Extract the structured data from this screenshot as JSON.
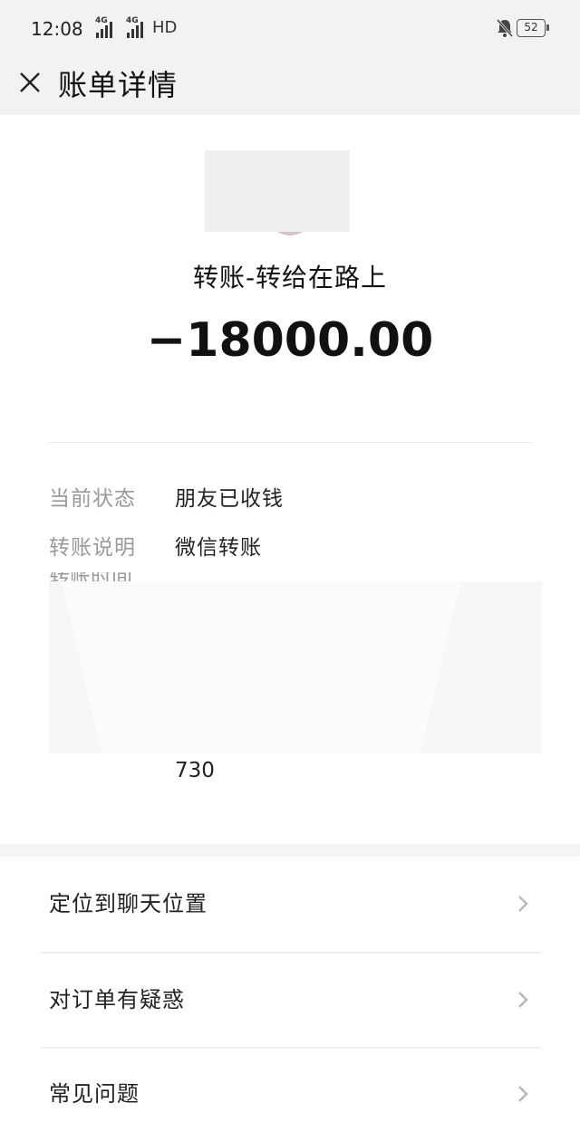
{
  "status_bar": {
    "time": "12:08",
    "network_1": "4G",
    "network_2": "4G",
    "hd": "HD",
    "battery": "52"
  },
  "header": {
    "title": "账单详情",
    "close_icon": "close-icon"
  },
  "transaction": {
    "title": "转账-转给在路上",
    "amount": "−18000.00"
  },
  "details": {
    "status_label": "当前状态",
    "status_value": "朋友已收钱",
    "note_label": "转账说明",
    "note_value": "微信转账",
    "order_value": "730"
  },
  "menu": {
    "items": [
      {
        "label": "定位到聊天位置",
        "icon": "chevron-right-icon"
      },
      {
        "label": "对订单有疑惑",
        "icon": "chevron-right-icon"
      },
      {
        "label": "常见问题",
        "icon": "chevron-right-icon"
      }
    ]
  },
  "colors": {
    "header_bg": "#f2f2f2",
    "label_gray": "#9a9a9a",
    "text": "#111111"
  }
}
